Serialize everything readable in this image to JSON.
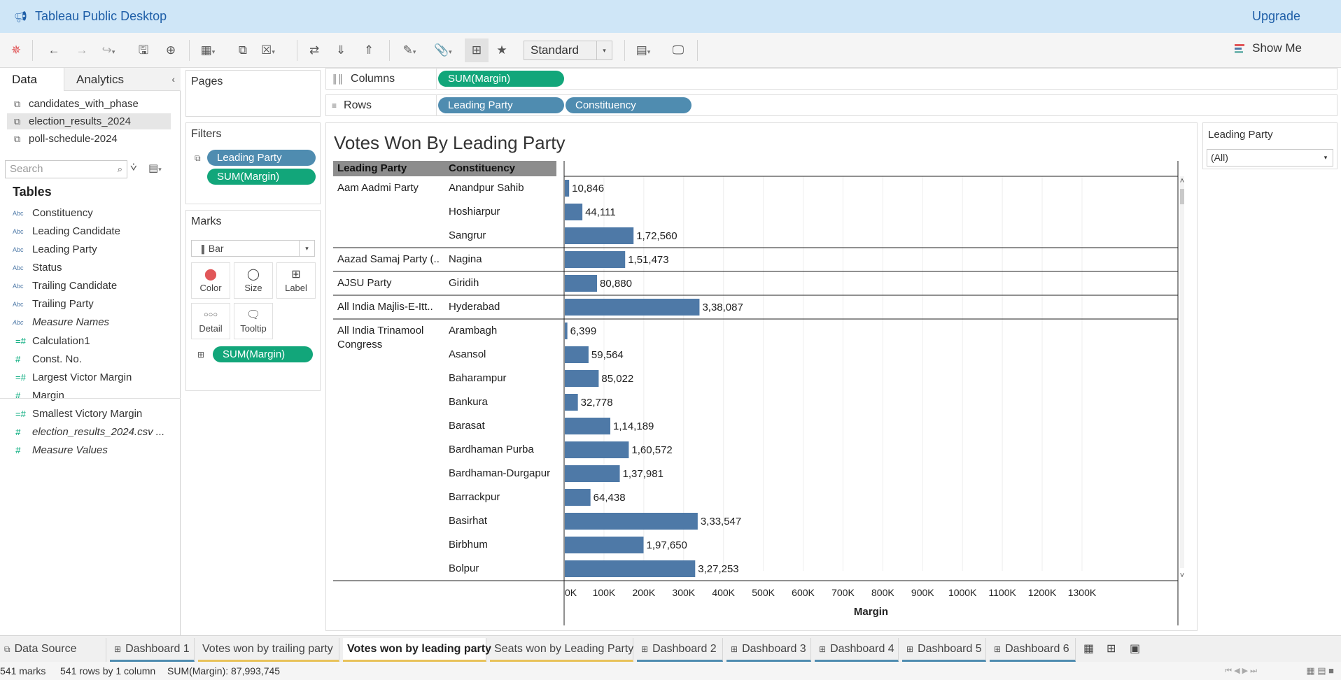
{
  "app": {
    "title": "Tableau Public Desktop",
    "upgrade": "Upgrade"
  },
  "toolbar": {
    "view_mode": "Standard",
    "show_me": "Show Me"
  },
  "data_pane": {
    "tab_data": "Data",
    "tab_analytics": "Analytics",
    "datasources": [
      "candidates_with_phase",
      "election_results_2024",
      "poll-schedule-2024"
    ],
    "search_placeholder": "Search",
    "tables_header": "Tables",
    "dimensions": [
      {
        "type": "Abc",
        "name": "Constituency"
      },
      {
        "type": "Abc",
        "name": "Leading Candidate"
      },
      {
        "type": "Abc",
        "name": "Leading Party"
      },
      {
        "type": "Abc",
        "name": "Status"
      },
      {
        "type": "Abc",
        "name": "Trailing Candidate"
      },
      {
        "type": "Abc",
        "name": "Trailing Party"
      },
      {
        "type": "Abc",
        "name": "Measure Names"
      }
    ],
    "measures": [
      {
        "type": "=#",
        "name": "Calculation1"
      },
      {
        "type": "#",
        "name": "Const. No."
      },
      {
        "type": "=#",
        "name": "Largest Victor Margin"
      },
      {
        "type": "#",
        "name": "Margin"
      },
      {
        "type": "=#",
        "name": "Smallest Victory Margin"
      },
      {
        "type": "#",
        "name": "election_results_2024.csv ..."
      },
      {
        "type": "#",
        "name": "Measure Values"
      }
    ]
  },
  "pages": {
    "title": "Pages"
  },
  "filters": {
    "title": "Filters",
    "items": [
      "Leading Party",
      "SUM(Margin)"
    ]
  },
  "marks": {
    "title": "Marks",
    "type": "Bar",
    "buttons": [
      "Color",
      "Size",
      "Label",
      "Detail",
      "Tooltip"
    ],
    "label_pill": "SUM(Margin)"
  },
  "shelves": {
    "columns_label": "Columns",
    "columns": [
      "SUM(Margin)"
    ],
    "rows_label": "Rows",
    "rows": [
      "Leading Party",
      "Constituency"
    ]
  },
  "legend": {
    "title": "Leading Party",
    "value": "(All)"
  },
  "sheet_tabs": [
    {
      "label": "Data Source",
      "kind": "datasource"
    },
    {
      "label": "Dashboard 1",
      "kind": "dash"
    },
    {
      "label": "Votes won by trailing party",
      "kind": "sheet"
    },
    {
      "label": "Votes won by leading party",
      "kind": "active"
    },
    {
      "label": "Seats won by Leading Party",
      "kind": "sheet"
    },
    {
      "label": "Dashboard 2",
      "kind": "dash"
    },
    {
      "label": "Dashboard 3",
      "kind": "dash"
    },
    {
      "label": "Dashboard 4",
      "kind": "dash"
    },
    {
      "label": "Dashboard 5",
      "kind": "dash"
    },
    {
      "label": "Dashboard 6",
      "kind": "dash"
    }
  ],
  "status": {
    "marks": "541 marks",
    "rows": "541 rows by 1 column",
    "sum": "SUM(Margin): 87,993,745"
  },
  "colors": {
    "bar": "#4e79a7",
    "pill_dimension": "#4f8cb0",
    "pill_measure": "#12a67a",
    "titlebar": "#cfe6f7"
  },
  "chart_data": {
    "type": "bar",
    "orientation": "horizontal",
    "title": "Votes Won By Leading Party",
    "row_headers": [
      "Leading Party",
      "Constituency"
    ],
    "xlabel": "Margin",
    "xlim": [
      0,
      1350000
    ],
    "x_ticks": [
      "0K",
      "100K",
      "200K",
      "300K",
      "400K",
      "500K",
      "600K",
      "700K",
      "800K",
      "900K",
      "1000K",
      "1100K",
      "1200K",
      "1300K"
    ],
    "x_tick_values": [
      0,
      100000,
      200000,
      300000,
      400000,
      500000,
      600000,
      700000,
      800000,
      900000,
      1000000,
      1100000,
      1200000,
      1300000
    ],
    "grid": "vertical",
    "groups": [
      {
        "party": "Aam Aadmi Party",
        "rows": [
          {
            "constituency": "Anandpur Sahib",
            "value": 10846,
            "label": "10,846"
          },
          {
            "constituency": "Hoshiarpur",
            "value": 44111,
            "label": "44,111"
          },
          {
            "constituency": "Sangrur",
            "value": 172560,
            "label": "1,72,560"
          }
        ]
      },
      {
        "party": "Aazad Samaj Party (..",
        "rows": [
          {
            "constituency": "Nagina",
            "value": 151473,
            "label": "1,51,473"
          }
        ]
      },
      {
        "party": "AJSU Party",
        "rows": [
          {
            "constituency": "Giridih",
            "value": 80880,
            "label": "80,880"
          }
        ]
      },
      {
        "party": "All India Majlis-E-Itt..",
        "rows": [
          {
            "constituency": "Hyderabad",
            "value": 338087,
            "label": "3,38,087"
          }
        ]
      },
      {
        "party": "All India Trinamool Congress",
        "rows": [
          {
            "constituency": "Arambagh",
            "value": 6399,
            "label": "6,399"
          },
          {
            "constituency": "Asansol",
            "value": 59564,
            "label": "59,564"
          },
          {
            "constituency": "Baharampur",
            "value": 85022,
            "label": "85,022"
          },
          {
            "constituency": "Bankura",
            "value": 32778,
            "label": "32,778"
          },
          {
            "constituency": "Barasat",
            "value": 114189,
            "label": "1,14,189"
          },
          {
            "constituency": "Bardhaman Purba",
            "value": 160572,
            "label": "1,60,572"
          },
          {
            "constituency": "Bardhaman-Durgapur",
            "value": 137981,
            "label": "1,37,981"
          },
          {
            "constituency": "Barrackpur",
            "value": 64438,
            "label": "64,438"
          },
          {
            "constituency": "Basirhat",
            "value": 333547,
            "label": "3,33,547"
          },
          {
            "constituency": "Birbhum",
            "value": 197650,
            "label": "1,97,650"
          },
          {
            "constituency": "Bolpur",
            "value": 327253,
            "label": "3,27,253"
          }
        ]
      }
    ]
  }
}
